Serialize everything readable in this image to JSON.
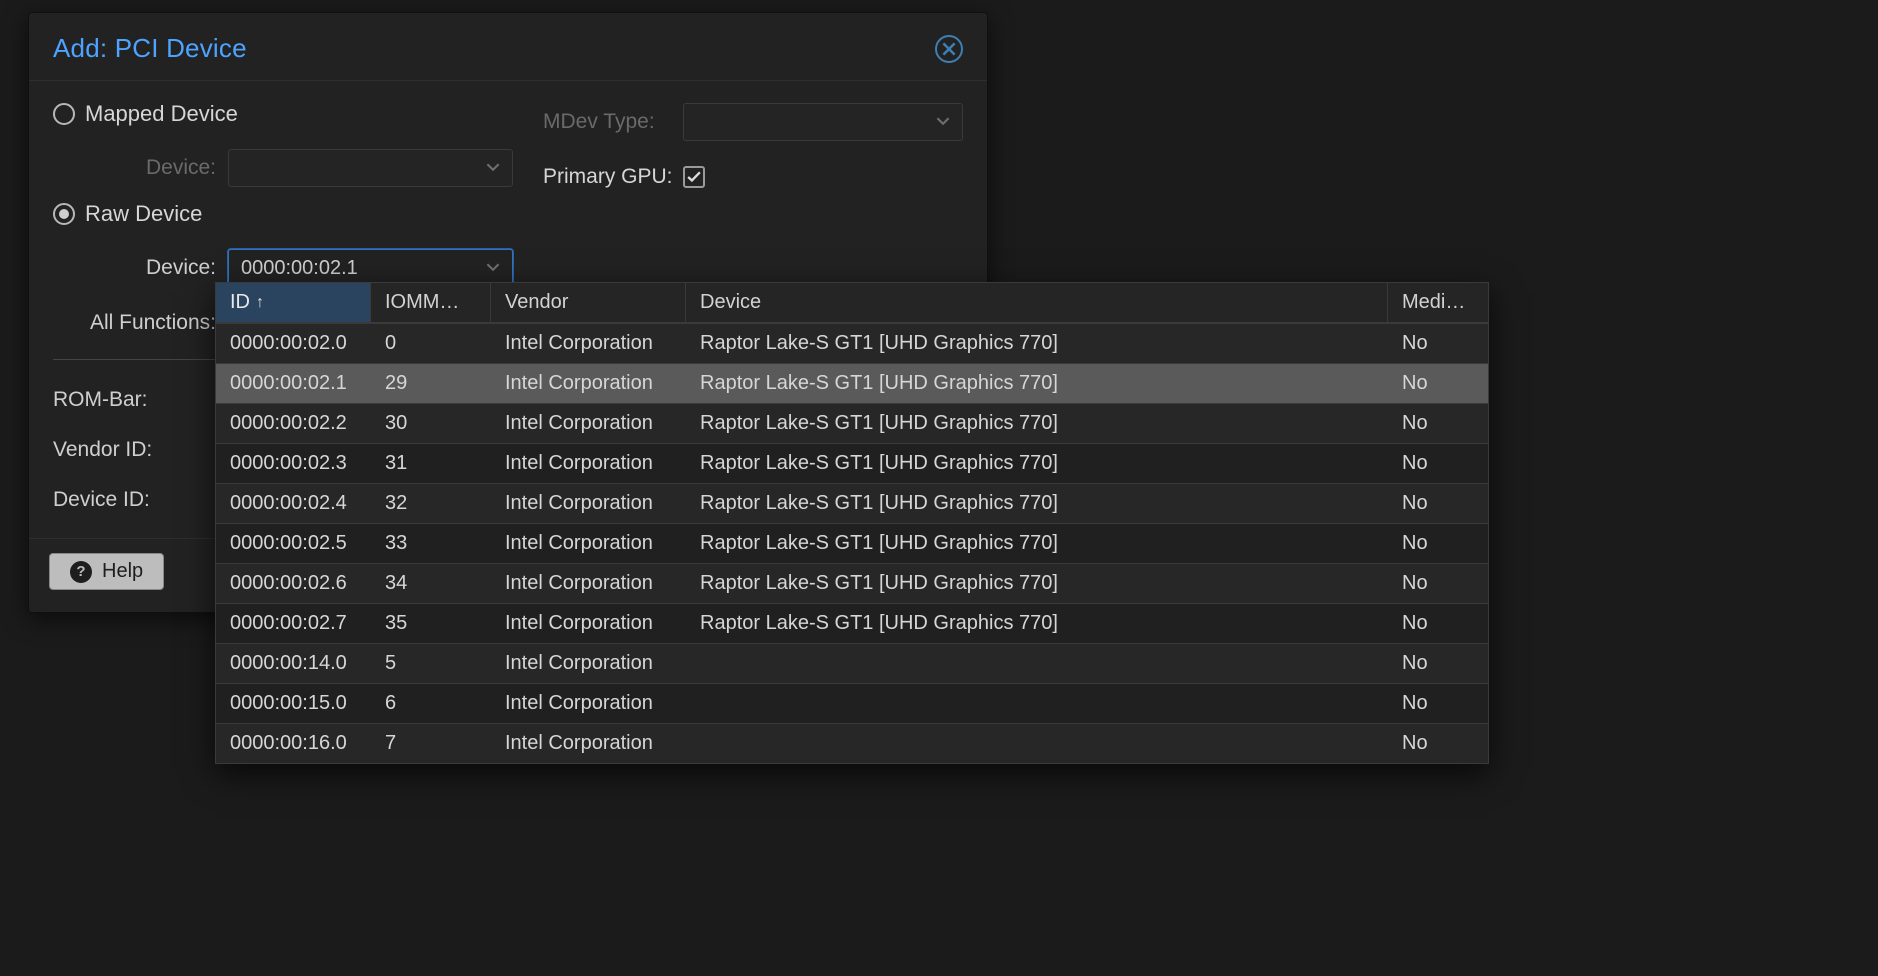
{
  "dialog": {
    "title": "Add: PCI Device",
    "radios": {
      "mapped_label": "Mapped Device",
      "raw_label": "Raw Device"
    },
    "left": {
      "device_label": "Device:",
      "all_functions_label": "All Functions:",
      "rom_bar_label": "ROM-Bar:",
      "vendor_id_label": "Vendor ID:",
      "device_id_label": "Device ID:",
      "device_value": "0000:00:02.1"
    },
    "right": {
      "mdev_label": "MDev Type:",
      "primary_gpu_label": "Primary GPU:"
    },
    "help_label": "Help"
  },
  "dropdown": {
    "columns": {
      "id": "ID",
      "iommu": "IOMM…",
      "vendor": "Vendor",
      "device": "Device",
      "media": "Medi…"
    },
    "rows": [
      {
        "id": "0000:00:02.0",
        "iommu": "0",
        "vendor": "Intel Corporation",
        "device": "Raptor Lake-S GT1 [UHD Graphics 770]",
        "media": "No",
        "selected": false
      },
      {
        "id": "0000:00:02.1",
        "iommu": "29",
        "vendor": "Intel Corporation",
        "device": "Raptor Lake-S GT1 [UHD Graphics 770]",
        "media": "No",
        "selected": true
      },
      {
        "id": "0000:00:02.2",
        "iommu": "30",
        "vendor": "Intel Corporation",
        "device": "Raptor Lake-S GT1 [UHD Graphics 770]",
        "media": "No",
        "selected": false
      },
      {
        "id": "0000:00:02.3",
        "iommu": "31",
        "vendor": "Intel Corporation",
        "device": "Raptor Lake-S GT1 [UHD Graphics 770]",
        "media": "No",
        "selected": false
      },
      {
        "id": "0000:00:02.4",
        "iommu": "32",
        "vendor": "Intel Corporation",
        "device": "Raptor Lake-S GT1 [UHD Graphics 770]",
        "media": "No",
        "selected": false
      },
      {
        "id": "0000:00:02.5",
        "iommu": "33",
        "vendor": "Intel Corporation",
        "device": "Raptor Lake-S GT1 [UHD Graphics 770]",
        "media": "No",
        "selected": false
      },
      {
        "id": "0000:00:02.6",
        "iommu": "34",
        "vendor": "Intel Corporation",
        "device": "Raptor Lake-S GT1 [UHD Graphics 770]",
        "media": "No",
        "selected": false
      },
      {
        "id": "0000:00:02.7",
        "iommu": "35",
        "vendor": "Intel Corporation",
        "device": "Raptor Lake-S GT1 [UHD Graphics 770]",
        "media": "No",
        "selected": false
      },
      {
        "id": "0000:00:14.0",
        "iommu": "5",
        "vendor": "Intel Corporation",
        "device": "",
        "media": "No",
        "selected": false
      },
      {
        "id": "0000:00:15.0",
        "iommu": "6",
        "vendor": "Intel Corporation",
        "device": "",
        "media": "No",
        "selected": false
      },
      {
        "id": "0000:00:16.0",
        "iommu": "7",
        "vendor": "Intel Corporation",
        "device": "",
        "media": "No",
        "selected": false
      }
    ]
  }
}
